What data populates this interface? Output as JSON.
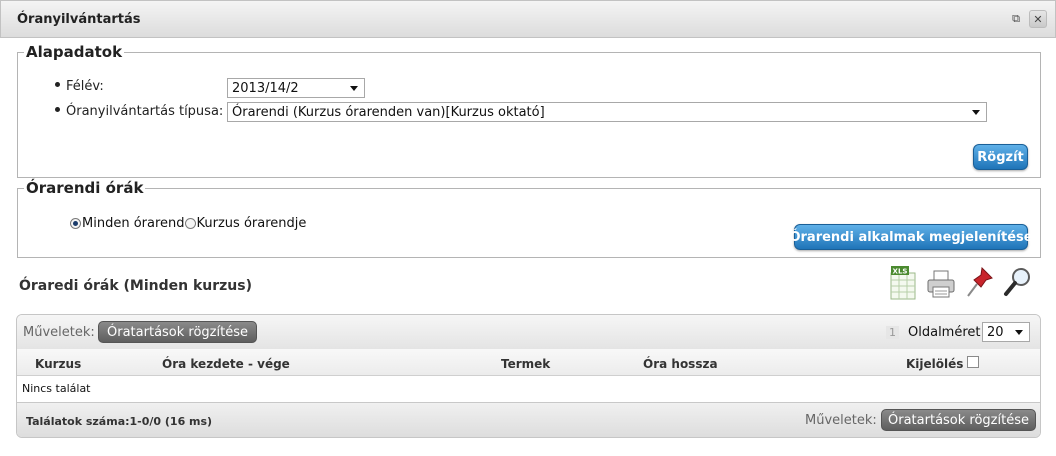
{
  "window": {
    "title": "Óranyilvántartás",
    "close_glyph": "✕",
    "popout_glyph": "⧉"
  },
  "basic": {
    "legend": "Alapadatok",
    "semester_label": "Félév:",
    "semester_value": "2013/14/2",
    "type_label": "Óranyilvántartás típusa:",
    "type_value": "Órarendi (Kurzus órarenden van)[Kurzus oktató]",
    "save_button": "Rögzít"
  },
  "timetable": {
    "legend": "Órarendi órák",
    "radio_all": "Minden órarend",
    "radio_course": "Kurzus órarendje",
    "radio_selected": "all",
    "show_button": "Órarendi alkalmak megjelenítése"
  },
  "list": {
    "title": "Óraredi órák (Minden kurzus)",
    "toolbar": {
      "actions_label": "Műveletek:",
      "record_button": "Óratartások rögzítése",
      "page_number": "1",
      "page_size_label": "Oldalméret",
      "page_size_value": "20"
    },
    "columns": [
      "Kurzus",
      "Óra kezdete - vége",
      "Termek",
      "Óra hossza",
      "Kijelölés"
    ],
    "empty_text": "Nincs találat",
    "footer": {
      "results": "Találatok száma:1-0/0 (16 ms)",
      "actions_label": "Műveletek:",
      "record_button": "Óratartások rögzítése"
    }
  },
  "icons": {
    "excel_label": "XLS",
    "export": "excel-export-icon",
    "print": "printer-icon",
    "pin": "pin-icon",
    "search": "magnifier-icon"
  }
}
